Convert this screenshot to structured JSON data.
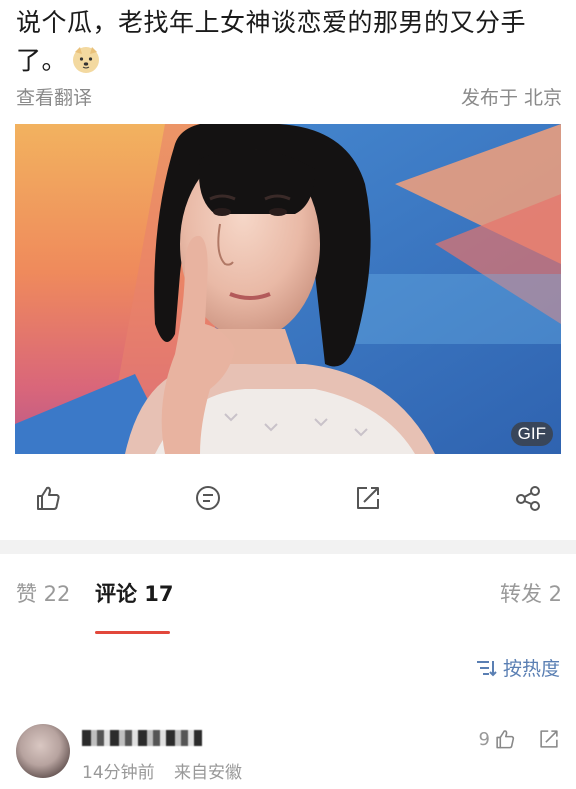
{
  "post": {
    "text": "说个瓜，老找年上女神谈恋爱的那男的又分手了。",
    "emoji": "dog-emoji",
    "translate_label": "查看翻译",
    "location": "发布于 北京"
  },
  "media": {
    "badge": "GIF"
  },
  "actions": {
    "like_icon": "thumbs-up-icon",
    "comment_icon": "comment-icon",
    "repost_icon": "share-arrow-icon",
    "share_icon": "share-nodes-icon"
  },
  "tabs": {
    "likes": "赞 22",
    "comments": "评论 17",
    "reposts": "转发 2"
  },
  "sort": {
    "label": "按热度"
  },
  "comment": {
    "time": "14分钟前",
    "source": "来自安徽",
    "like_count": "9"
  },
  "colors": {
    "accent": "#e2473b",
    "link": "#5a7fb3",
    "muted": "#999999"
  }
}
